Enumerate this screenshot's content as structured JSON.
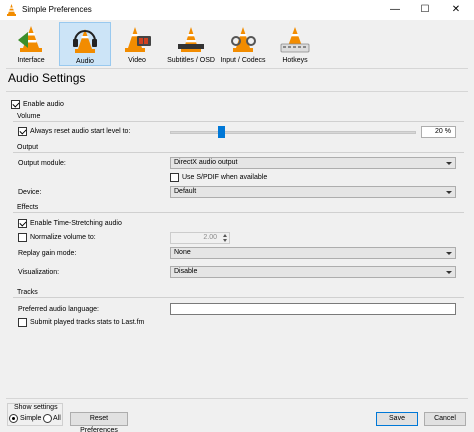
{
  "window": {
    "title": "Simple Preferences",
    "minimize": "—",
    "maximize": "☐",
    "close": "✕"
  },
  "toolbar": {
    "items": [
      {
        "label": "Interface",
        "icon": "cone-interface-icon",
        "selected": false
      },
      {
        "label": "Audio",
        "icon": "headphones-cone-icon",
        "selected": true
      },
      {
        "label": "Video",
        "icon": "film-cone-icon",
        "selected": false
      },
      {
        "label": "Subtitles / OSD",
        "icon": "subtitles-cone-icon",
        "selected": false
      },
      {
        "label": "Input / Codecs",
        "icon": "codecs-cone-icon",
        "selected": false
      },
      {
        "label": "Hotkeys",
        "icon": "hotkeys-cone-icon",
        "selected": false
      }
    ]
  },
  "page": {
    "title": "Audio Settings"
  },
  "enable_audio": {
    "label": "Enable audio",
    "checked": true
  },
  "volume": {
    "title": "Volume",
    "reset_label": "Always reset audio start level to:",
    "reset_checked": true,
    "level_fraction": 0.2,
    "level_text": "20 %"
  },
  "output": {
    "title": "Output",
    "module_label": "Output module:",
    "module_value": "DirectX audio output",
    "spdif_label": "Use S/PDIF when available",
    "spdif_checked": false,
    "device_label": "Device:",
    "device_value": "Default"
  },
  "effects": {
    "title": "Effects",
    "stretch_label": "Enable Time-Stretching audio",
    "stretch_checked": true,
    "normalize_label": "Normalize volume to:",
    "normalize_checked": false,
    "normalize_value": "2.00",
    "replay_label": "Replay gain mode:",
    "replay_value": "None",
    "visualization_label": "Visualization:",
    "visualization_value": "Disable"
  },
  "tracks": {
    "title": "Tracks",
    "pref_lang_label": "Preferred audio language:",
    "pref_lang_value": "",
    "lastfm_label": "Submit played tracks stats to Last.fm",
    "lastfm_checked": false
  },
  "footer": {
    "show_settings_title": "Show settings",
    "simple_label": "Simple",
    "all_label": "All",
    "selected": "Simple",
    "reset_button": "Reset Preferences",
    "save_button": "Save",
    "cancel_button": "Cancel"
  },
  "colors": {
    "accent": "#0078d7",
    "selected_tab": "#cce4f7",
    "cone_orange": "#f28c00"
  }
}
